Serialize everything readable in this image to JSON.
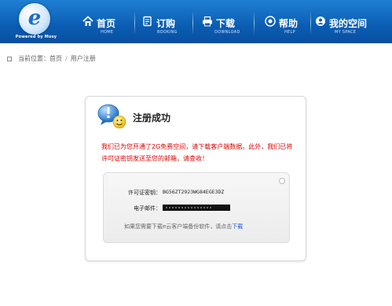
{
  "logo": {
    "letter": "e",
    "tagline": "Powered by Mosy"
  },
  "nav": [
    {
      "label": "首页",
      "sub": "HOME",
      "icon": "home-icon"
    },
    {
      "label": "订购",
      "sub": "BOOKING",
      "icon": "booking-icon"
    },
    {
      "label": "下载",
      "sub": "DOWNLOAD",
      "icon": "printer-icon"
    },
    {
      "label": "帮助",
      "sub": "HELP",
      "icon": "help-icon"
    },
    {
      "label": "我的空间",
      "sub": "MY SPACE",
      "icon": "user-space-icon"
    }
  ],
  "breadcrumb": {
    "prefix": "当前位置：",
    "items": [
      "首页",
      "用户注册"
    ],
    "separator": "/"
  },
  "card": {
    "title": "注册成功",
    "message": "我们已为您开通了2G免费空间，请下载客户端数据。此外，我们已将许可证密钥发送至您的邮箱，请查收！",
    "license_label": "许可证密钥：",
    "license_value": "BG56ZT2923WG84EGE3DZ",
    "email_label": "电子邮件：",
    "email_value": "",
    "hint_text": "如果您需要下载e云客户端备份软件，请点击",
    "hint_link": "下载"
  },
  "colors": {
    "header": "#0a5db3",
    "message": "#e00000",
    "link": "#1a4fc8"
  }
}
